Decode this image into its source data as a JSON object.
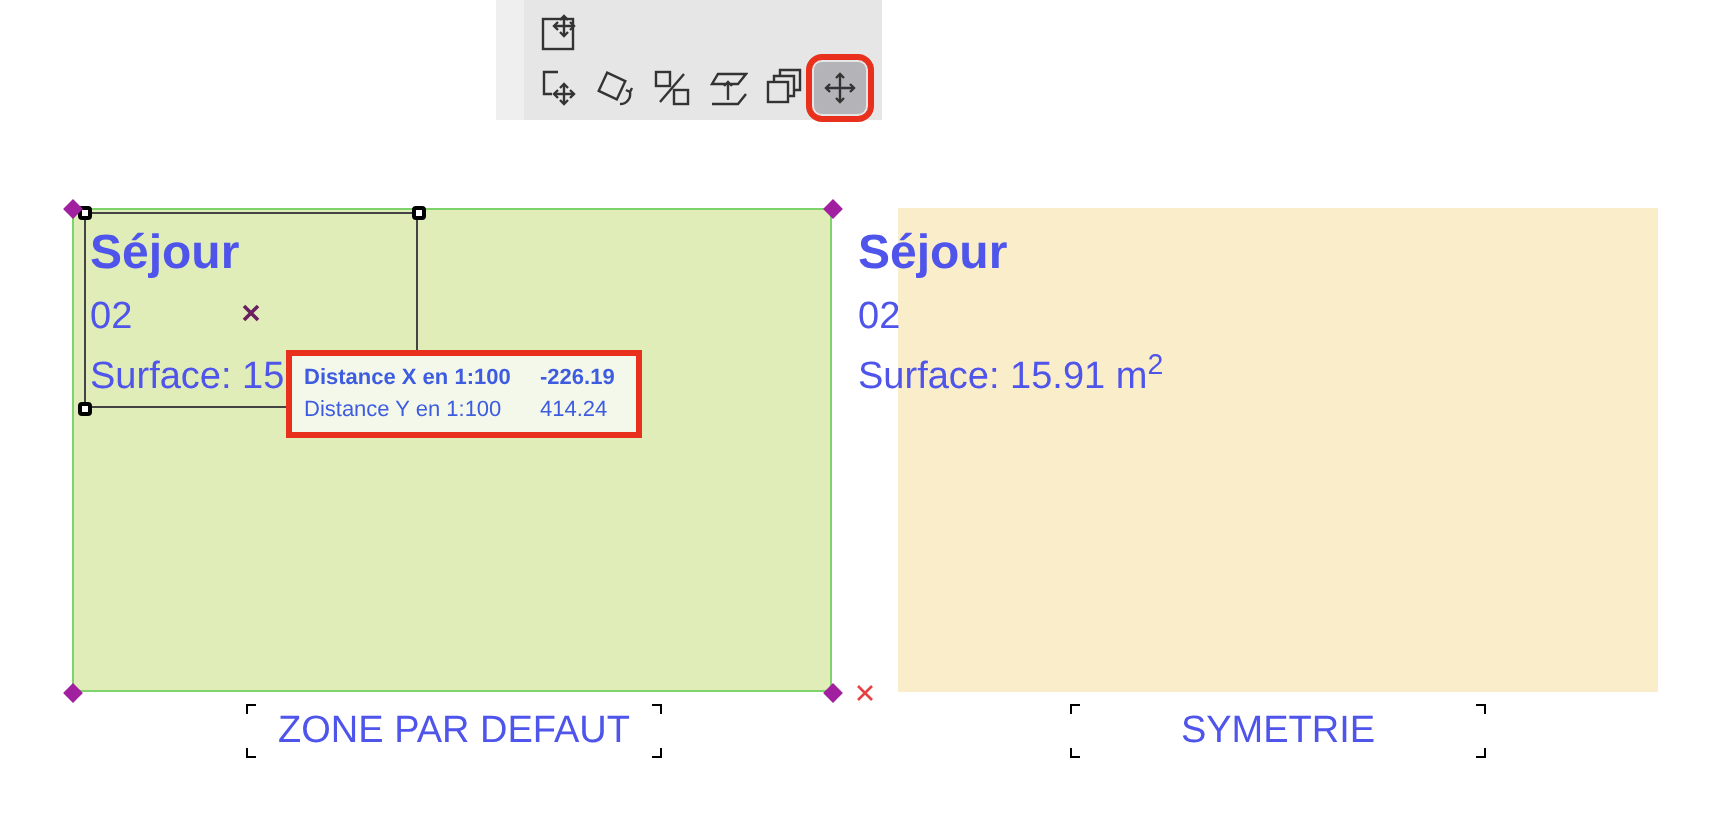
{
  "toolbar": {
    "top_tools": [
      {
        "kind": "frame-move",
        "selected": false
      }
    ],
    "tools": [
      {
        "kind": "drag",
        "selected": false
      },
      {
        "kind": "rotate",
        "selected": false
      },
      {
        "kind": "mirror",
        "selected": false
      },
      {
        "kind": "elevate",
        "selected": false
      },
      {
        "kind": "multiply",
        "selected": false
      },
      {
        "kind": "move",
        "selected": true
      }
    ]
  },
  "zones": [
    {
      "name": "Séjour",
      "number": "02",
      "surface": "Surface: 15",
      "color": "#e0edb8",
      "selected": true,
      "label": "ZONE PAR DEFAUT"
    },
    {
      "name": "Séjour",
      "number": "02",
      "surface": "Surface: 15.91 m$^{2}$",
      "color": "#faedc9",
      "selected": false,
      "label": "SYMETRIE"
    }
  ],
  "tooltip": {
    "rows": [
      {
        "label": "Distance X en 1:100",
        "value": "-226.19",
        "emphasized": true
      },
      {
        "label": "Distance Y en 1:100",
        "value": "414.24",
        "emphasized": false
      }
    ]
  }
}
